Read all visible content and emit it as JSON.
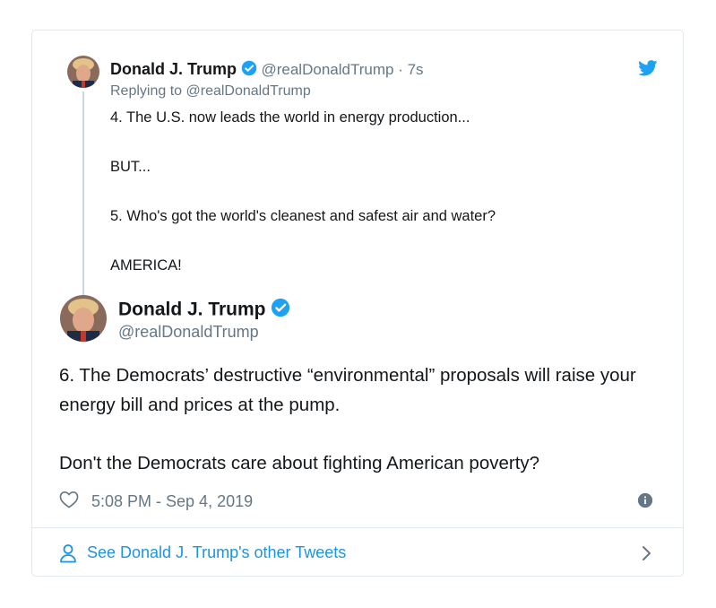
{
  "parent_tweet": {
    "display_name": "Donald J. Trump",
    "handle": "@realDonaldTrump",
    "separator": "·",
    "time_ago": "7s",
    "replying_to": "Replying to @realDonaldTrump",
    "lines": [
      "4. The U.S. now leads the world in energy production...",
      "",
      "BUT...",
      "",
      "5. Who's got the world's cleanest and safest air and water?",
      "",
      "AMERICA!"
    ]
  },
  "main_tweet": {
    "display_name": "Donald J. Trump",
    "handle": "@realDonaldTrump",
    "paragraphs": [
      "6. The Democrats’ destructive “environmental” proposals will raise your energy bill and prices at the pump.",
      "Don't the Democrats care about fighting American poverty?"
    ],
    "timestamp": "5:08 PM - Sep 4, 2019"
  },
  "footer": {
    "link_text": "See Donald J. Trump's other Tweets"
  },
  "icons": {
    "verified": "verified-badge-icon",
    "bird": "twitter-bird-icon",
    "like": "heart-icon",
    "info": "info-icon",
    "person": "person-icon",
    "chevron": "chevron-right-icon"
  },
  "colors": {
    "twitter_blue": "#1da1f2",
    "link_blue": "#1b95e0",
    "muted": "#657786",
    "border": "#e1e8ed"
  }
}
